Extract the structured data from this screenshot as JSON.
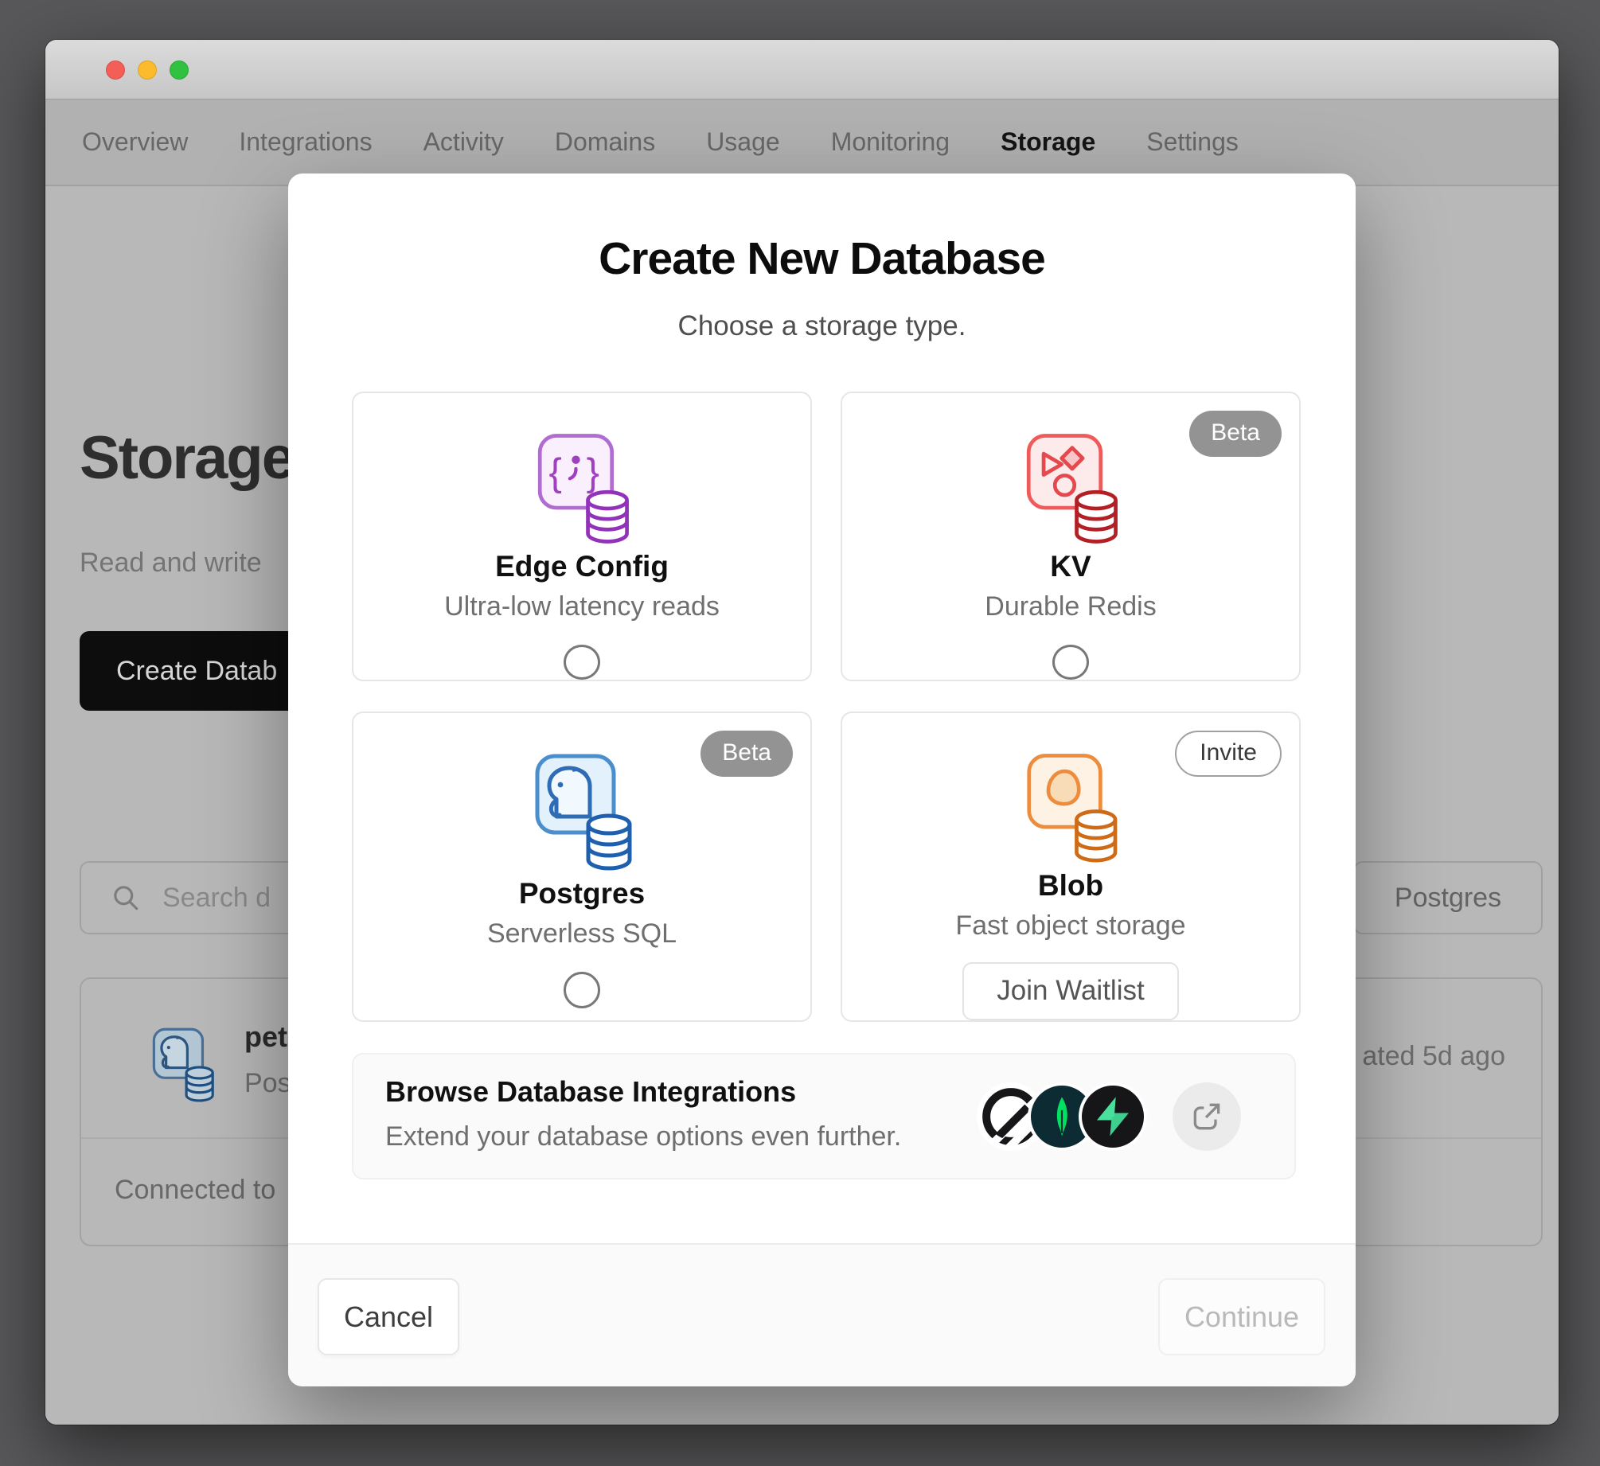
{
  "window": {
    "traffic_lights": [
      "close",
      "minimize",
      "zoom"
    ]
  },
  "nav": {
    "items": [
      {
        "label": "Overview",
        "active": false
      },
      {
        "label": "Integrations",
        "active": false
      },
      {
        "label": "Activity",
        "active": false
      },
      {
        "label": "Domains",
        "active": false
      },
      {
        "label": "Usage",
        "active": false
      },
      {
        "label": "Monitoring",
        "active": false
      },
      {
        "label": "Storage",
        "active": true
      },
      {
        "label": "Settings",
        "active": false
      }
    ]
  },
  "page": {
    "title": "Storage",
    "subtitle": "Read and write",
    "create_button_label": "Create Datab",
    "search_placeholder": "Search d",
    "type_filter_label": "Postgres",
    "database": {
      "name": "petsto",
      "type": "Postg",
      "updated": "ated 5d ago",
      "connection": "Connected to"
    }
  },
  "modal": {
    "title": "Create New Database",
    "subtitle": "Choose a storage type.",
    "options": [
      {
        "name": "Edge Config",
        "description": "Ultra-low latency reads",
        "badge": "",
        "control": "radio"
      },
      {
        "name": "KV",
        "description": "Durable Redis",
        "badge": "Beta",
        "control": "radio"
      },
      {
        "name": "Postgres",
        "description": "Serverless SQL",
        "badge": "Beta",
        "control": "radio"
      },
      {
        "name": "Blob",
        "description": "Fast object storage",
        "badge": "Invite",
        "control": "button",
        "button_label": "Join Waitlist"
      }
    ],
    "integrations": {
      "title": "Browse Database Integrations",
      "subtitle": "Extend your database options even further.",
      "logos": [
        "planetscale-logo",
        "mongodb-logo",
        "supabase-logo"
      ]
    },
    "footer": {
      "cancel_label": "Cancel",
      "continue_label": "Continue"
    }
  },
  "colors": {
    "edge_config_accent": "#a040c0",
    "kv_accent": "#e5484d",
    "postgres_accent": "#2e6cb5",
    "blob_accent": "#ec8c3c",
    "mongodb_green": "#00e061",
    "supabase_green": "#3ecf8e",
    "badge_gray": "#939393",
    "modal_bg": "#ffffff",
    "overlay_gray": "#b8b8b8"
  }
}
